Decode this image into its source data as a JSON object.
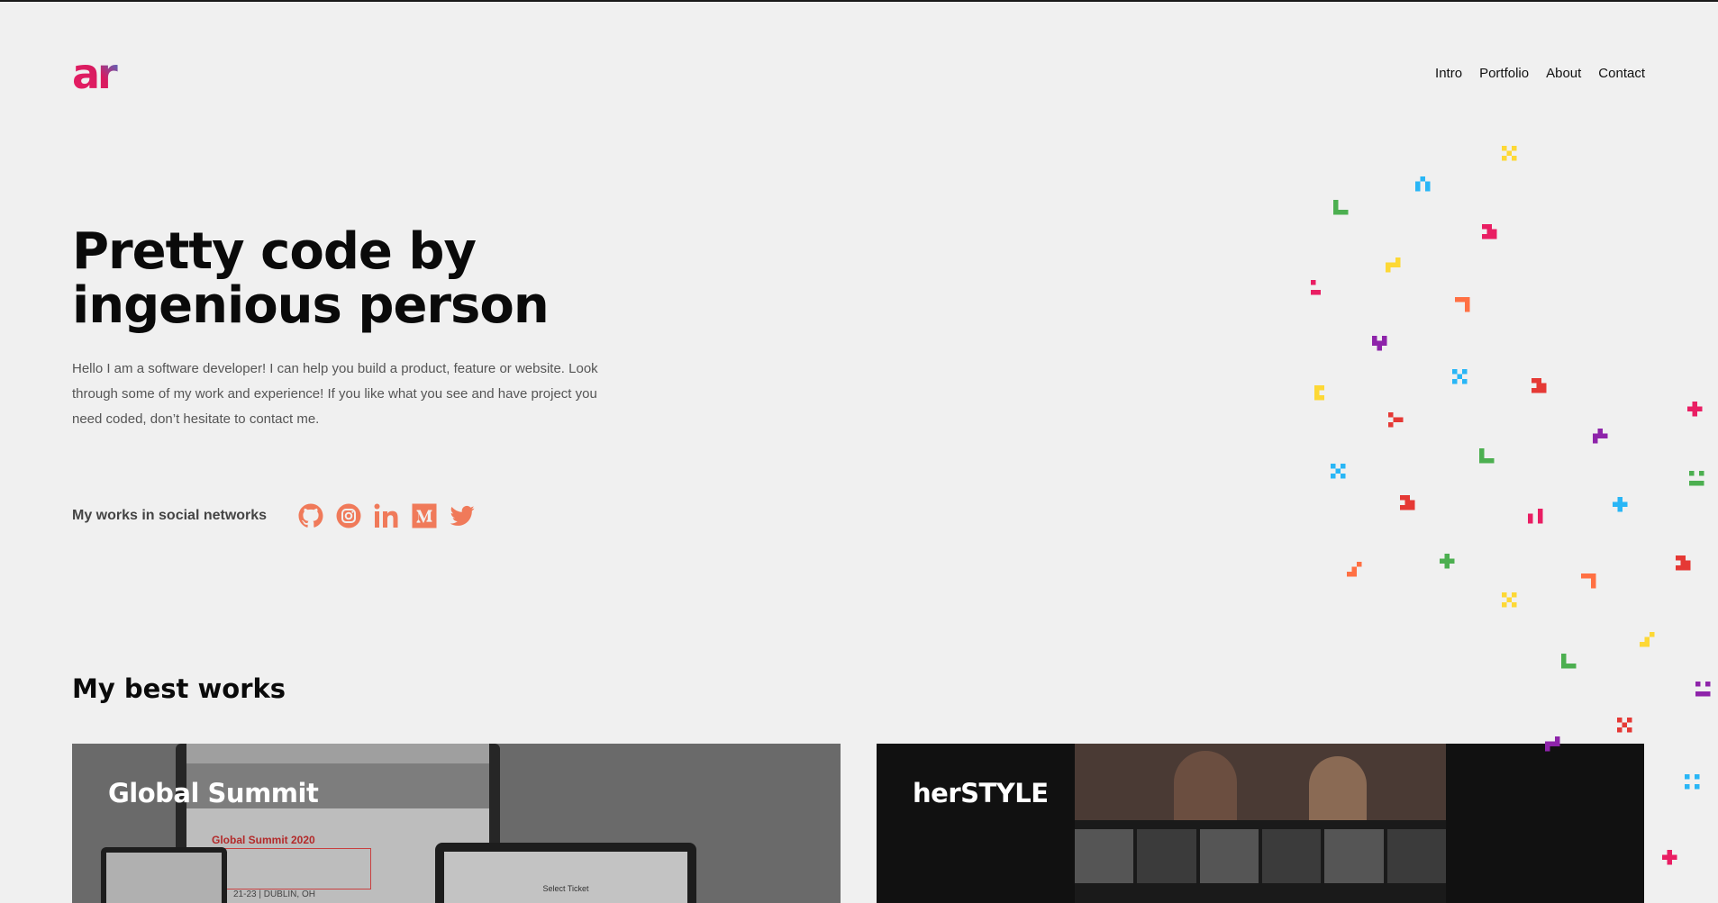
{
  "brand": {
    "logo_text": "ar",
    "colors": {
      "pink": "#e91e63",
      "blue": "#1e88e5",
      "accent": "#f07a5a"
    }
  },
  "nav": {
    "items": [
      {
        "label": "Intro"
      },
      {
        "label": "Portfolio"
      },
      {
        "label": "About"
      },
      {
        "label": "Contact"
      }
    ]
  },
  "hero": {
    "title": "Pretty code by ingenious person",
    "description": "Hello I am a software developer! I can help you build a product, feature or website. Look through some of my work and experience! If you like what you see and have project you need coded, don’t hesitate to contact me."
  },
  "social": {
    "label": "My works in social networks",
    "icons": [
      "github-icon",
      "instagram-icon",
      "linkedin-icon",
      "medium-icon",
      "twitter-icon"
    ],
    "icon_color": "#f07a5a"
  },
  "works": {
    "title": "My best works",
    "items": [
      {
        "title": "Global Summit",
        "mock_heading": "Global Summit 2020",
        "mock_date": "21-23 | DUBLIN, OH",
        "mock_tablet_text": "Select Ticket"
      },
      {
        "title": "herSTYLE"
      }
    ]
  },
  "decor": {
    "pixel_colors": [
      "#fdd835",
      "#29b6f6",
      "#4caf50",
      "#e91e63",
      "#ff7043",
      "#8e24aa",
      "#e53935"
    ]
  }
}
